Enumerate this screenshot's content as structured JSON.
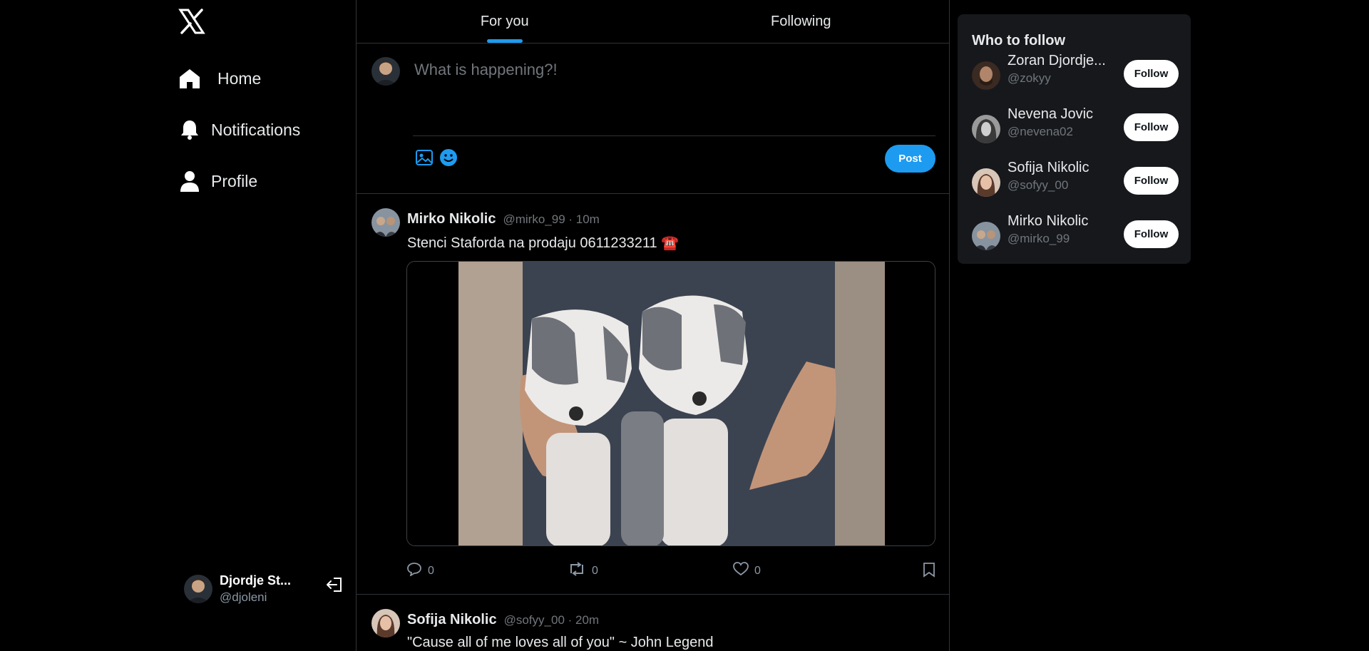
{
  "sidebar": {
    "logo": "x-logo-icon",
    "items": [
      {
        "label": "Home",
        "icon": "home-icon"
      },
      {
        "label": "Notifications",
        "icon": "bell-icon"
      },
      {
        "label": "Profile",
        "icon": "person-icon"
      }
    ],
    "account": {
      "name": "Djordje St...",
      "handle": "@djoleni"
    }
  },
  "tabs": [
    {
      "label": "For you",
      "active": true
    },
    {
      "label": "Following",
      "active": false
    }
  ],
  "composer": {
    "placeholder": "What is happening?!",
    "post_label": "Post"
  },
  "tweets": [
    {
      "name": "Mirko Nikolic",
      "meta": "@mirko_99 · 10m",
      "text": "Stenci Staforda na prodaju 0611233211 ☎️",
      "replies": "0",
      "reposts": "0",
      "likes": "0"
    },
    {
      "name": "Sofija Nikolic",
      "meta": "@sofyy_00 · 20m",
      "text": "\"Cause all of me loves all of you\" ~ John Legend"
    }
  ],
  "who_to_follow": {
    "title": "Who to follow",
    "follow_label": "Follow",
    "users": [
      {
        "name": "Zoran Djordje...",
        "handle": "@zokyy"
      },
      {
        "name": "Nevena Jovic",
        "handle": "@nevena02"
      },
      {
        "name": "Sofija Nikolic",
        "handle": "@sofyy_00"
      },
      {
        "name": "Mirko Nikolic",
        "handle": "@mirko_99"
      }
    ]
  },
  "colors": {
    "accent": "#1d9bf0",
    "background": "#000000",
    "card": "#16181c"
  }
}
